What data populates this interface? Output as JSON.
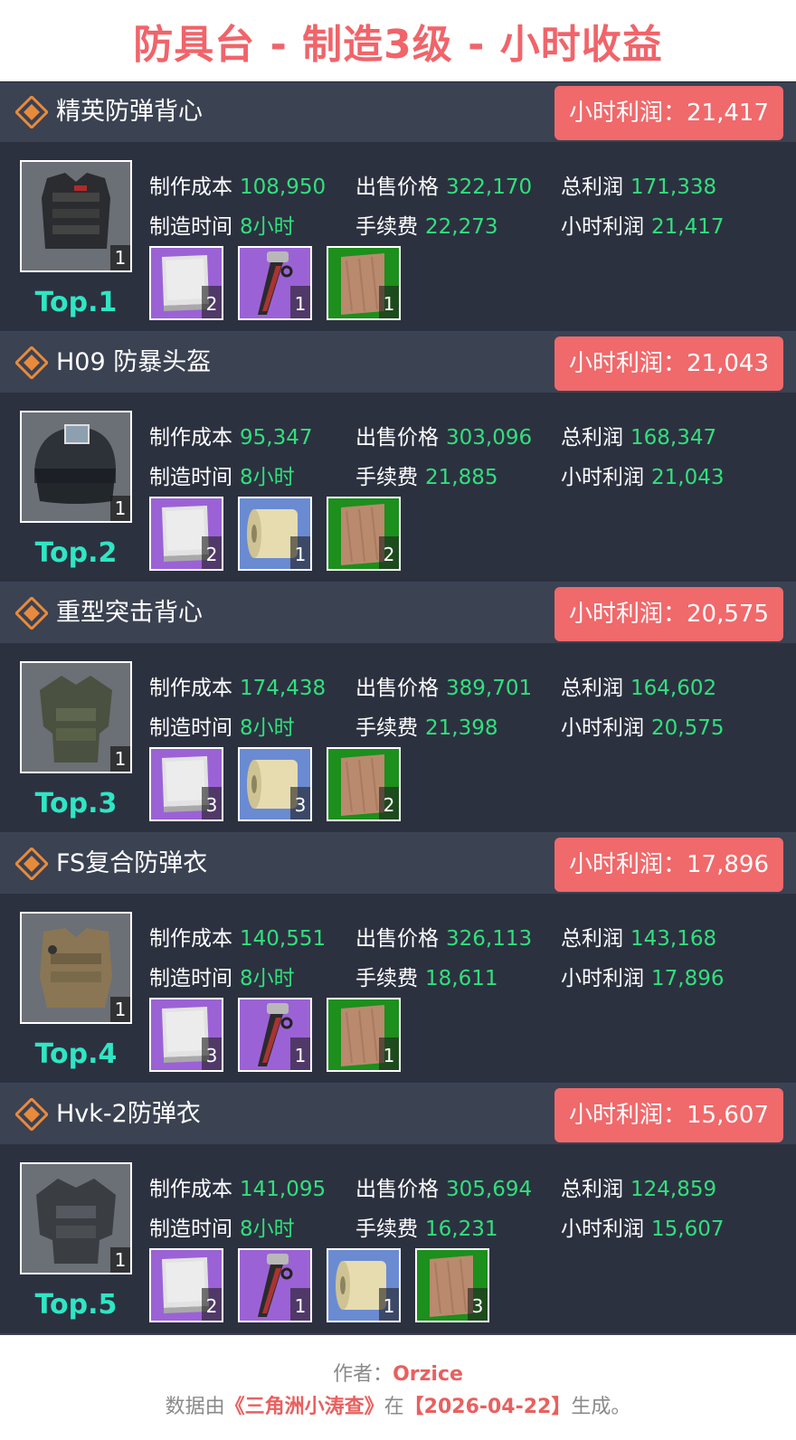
{
  "title": "防具台 - 制造3级 - 小时收益",
  "labels": {
    "cost": "制作成本",
    "sell": "出售价格",
    "total": "总利润",
    "time": "制造时间",
    "fee": "手续费",
    "hourly": "小时利润"
  },
  "items": [
    {
      "name": "精英防弹背心",
      "badge": "小时利润：21,417",
      "rank": "Top.1",
      "thumb_icon": "elite-vest-icon",
      "thumb_count": "1",
      "cost": "108,950",
      "sell": "322,170",
      "total": "171,338",
      "time": "8小时",
      "fee": "22,273",
      "hourly": "21,417",
      "materials": [
        {
          "icon": "cloth-sheet-icon",
          "color": "purple",
          "count": "2"
        },
        {
          "icon": "pump-tool-icon",
          "color": "purple",
          "count": "1"
        },
        {
          "icon": "wood-panel-icon",
          "color": "green",
          "count": "1"
        }
      ]
    },
    {
      "name": "H09 防暴头盔",
      "badge": "小时利润：21,043",
      "rank": "Top.2",
      "thumb_icon": "riot-helmet-icon",
      "thumb_count": "1",
      "cost": "95,347",
      "sell": "303,096",
      "total": "168,347",
      "time": "8小时",
      "fee": "21,885",
      "hourly": "21,043",
      "materials": [
        {
          "icon": "cloth-sheet-icon",
          "color": "purple",
          "count": "2"
        },
        {
          "icon": "fabric-roll-icon",
          "color": "blue",
          "count": "1"
        },
        {
          "icon": "wood-panel-icon",
          "color": "green",
          "count": "2"
        }
      ]
    },
    {
      "name": "重型突击背心",
      "badge": "小时利润：20,575",
      "rank": "Top.3",
      "thumb_icon": "assault-vest-icon",
      "thumb_count": "1",
      "cost": "174,438",
      "sell": "389,701",
      "total": "164,602",
      "time": "8小时",
      "fee": "21,398",
      "hourly": "20,575",
      "materials": [
        {
          "icon": "cloth-sheet-icon",
          "color": "purple",
          "count": "3"
        },
        {
          "icon": "fabric-roll-icon",
          "color": "blue",
          "count": "3"
        },
        {
          "icon": "wood-panel-icon",
          "color": "green",
          "count": "2"
        }
      ]
    },
    {
      "name": "FS复合防弹衣",
      "badge": "小时利润：17,896",
      "rank": "Top.4",
      "thumb_icon": "composite-armor-icon",
      "thumb_count": "1",
      "cost": "140,551",
      "sell": "326,113",
      "total": "143,168",
      "time": "8小时",
      "fee": "18,611",
      "hourly": "17,896",
      "materials": [
        {
          "icon": "cloth-sheet-icon",
          "color": "purple",
          "count": "3"
        },
        {
          "icon": "pump-tool-icon",
          "color": "purple",
          "count": "1"
        },
        {
          "icon": "wood-panel-icon",
          "color": "green",
          "count": "1"
        }
      ]
    },
    {
      "name": "Hvk-2防弹衣",
      "badge": "小时利润：15,607",
      "rank": "Top.5",
      "thumb_icon": "hvk-armor-icon",
      "thumb_count": "1",
      "cost": "141,095",
      "sell": "305,694",
      "total": "124,859",
      "time": "8小时",
      "fee": "16,231",
      "hourly": "15,607",
      "materials": [
        {
          "icon": "cloth-sheet-icon",
          "color": "purple",
          "count": "2"
        },
        {
          "icon": "pump-tool-icon",
          "color": "purple",
          "count": "1"
        },
        {
          "icon": "fabric-roll-icon",
          "color": "blue",
          "count": "1"
        },
        {
          "icon": "wood-panel-icon",
          "color": "green",
          "count": "3"
        }
      ]
    }
  ],
  "footer": {
    "author_label": "作者：",
    "author": "Orzice",
    "line2_prefix": "数据由",
    "source": "《三角洲小涛查》",
    "line2_mid": "在",
    "date": "【2026-04-22】",
    "line2_suffix": "生成。"
  },
  "colors": {
    "title": "#f0646a",
    "value": "#31e07c",
    "rank": "#2fe6c4",
    "badge": "#f0696b",
    "board": "#2c3140"
  }
}
